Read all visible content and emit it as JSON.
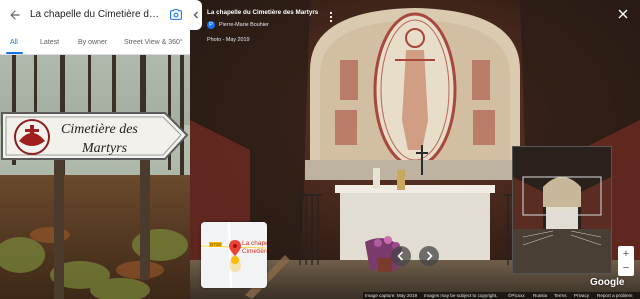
{
  "left_panel": {
    "title": "La chapelle du Cimetière des Ma...",
    "tabs": [
      {
        "label": "All",
        "active": true
      },
      {
        "label": "Latest",
        "active": false
      },
      {
        "label": "By owner",
        "active": false
      },
      {
        "label": "Street View & 360°",
        "active": false
      }
    ],
    "sign_text_line1": "Cimetière des",
    "sign_text_line2": "Martyrs"
  },
  "viewer": {
    "place_name": "La chapelle du Cimetière des Martyrs",
    "author_initial": "P",
    "author": "Pierre-Marie Bouhier",
    "date": "Photo - May 2019",
    "logo": "Google"
  },
  "map_thumb": {
    "label_line1": "La chape",
    "label_line2": "Cimetière",
    "road_label": "D716"
  },
  "zoom": {
    "plus": "+",
    "minus": "−"
  },
  "footer": {
    "capture": "Image capture: May 2019",
    "copyright": "Images may be subject to copyright.",
    "google_copyright": "©Picxxx",
    "region": "Russia",
    "terms": "Terms",
    "privacy": "Privacy",
    "report": "Report a problem"
  },
  "colors": {
    "accent": "#1a73e8",
    "map_pin": "#d93025"
  }
}
